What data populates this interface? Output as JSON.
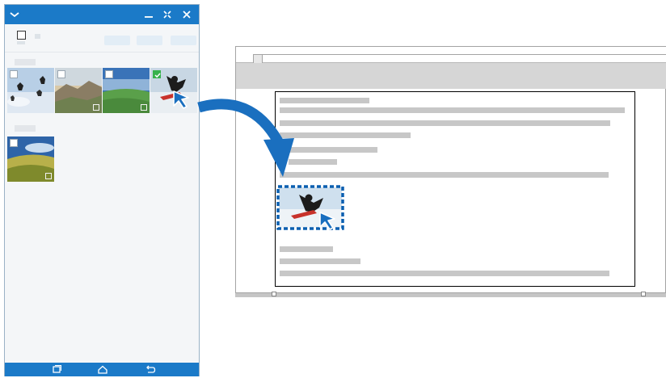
{
  "phone": {
    "top_icons": [
      "chevron-down-icon",
      "minimize-icon",
      "restore-icon",
      "close-icon"
    ],
    "nav_icons": [
      "recent-apps-icon",
      "home-icon",
      "back-icon"
    ],
    "thumbnails": [
      {
        "name": "photo-snow-jumpers",
        "checked": false
      },
      {
        "name": "photo-mountain-sunset",
        "checked": false
      },
      {
        "name": "photo-green-field",
        "checked": false
      },
      {
        "name": "photo-snowboarder",
        "checked": true
      },
      {
        "name": "photo-grass-field",
        "checked": false
      }
    ]
  },
  "colors": {
    "accent": "#1b7ac8",
    "arrow": "#1a6fbf",
    "check": "#37b24d",
    "selection_border": "#0a5fb0"
  }
}
